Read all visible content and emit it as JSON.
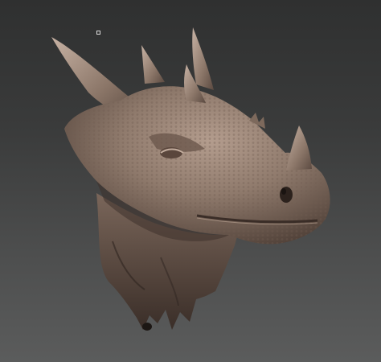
{
  "viewport": {
    "background_top": "#2f3030",
    "background_bottom": "#5b5c5c"
  },
  "model": {
    "subject": "dragon-head-sculpt",
    "material_color": "#8a7567",
    "highlight_color": "#b49d8e",
    "shadow_color": "#3e312b"
  },
  "overlay": {
    "icon": "pivot-marker-icon"
  }
}
